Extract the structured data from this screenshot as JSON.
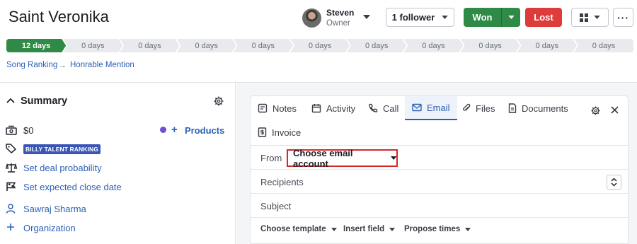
{
  "deal": {
    "title": "Saint Veronika"
  },
  "owner": {
    "name": "Steven",
    "role": "Owner"
  },
  "actions": {
    "follower_label": "1 follower",
    "won_label": "Won",
    "lost_label": "Lost",
    "more_label": "···"
  },
  "pipeline": {
    "stages": [
      {
        "label": "12 days",
        "active": true
      },
      {
        "label": "0 days",
        "active": false
      },
      {
        "label": "0 days",
        "active": false
      },
      {
        "label": "0 days",
        "active": false
      },
      {
        "label": "0 days",
        "active": false
      },
      {
        "label": "0 days",
        "active": false
      },
      {
        "label": "0 days",
        "active": false
      },
      {
        "label": "0 days",
        "active": false
      },
      {
        "label": "0 days",
        "active": false
      },
      {
        "label": "0 days",
        "active": false
      },
      {
        "label": "0 days",
        "active": false
      }
    ]
  },
  "breadcrumb": {
    "pipeline": "Song Ranking",
    "stage": "Honrable Mention"
  },
  "summary": {
    "title": "Summary",
    "value": "$0",
    "products_label": "Products",
    "tag": "BILLY TALENT RANKING",
    "probability_link": "Set deal probability",
    "close_date_link": "Set expected close date",
    "person": "Sawraj Sharma",
    "organization": "Organization"
  },
  "composer": {
    "tabs": [
      {
        "label": "Notes",
        "icon": "note-icon"
      },
      {
        "label": "Activity",
        "icon": "calendar-icon"
      },
      {
        "label": "Call",
        "icon": "phone-icon"
      },
      {
        "label": "Email",
        "icon": "envelope-icon",
        "active": true
      },
      {
        "label": "Files",
        "icon": "paperclip-icon"
      },
      {
        "label": "Documents",
        "icon": "document-icon"
      },
      {
        "label": "Invoice",
        "icon": "invoice-icon"
      }
    ],
    "from_label": "From",
    "from_value": "Choose email account",
    "recipients_label": "Recipients",
    "subject_label": "Subject",
    "toolbar": {
      "template": "Choose template",
      "insert": "Insert field",
      "propose": "Propose times"
    }
  },
  "colors": {
    "accent": "#2b5fb4",
    "won": "#2e8a46",
    "lost": "#de3b3b",
    "highlight_border": "#d8262a"
  }
}
